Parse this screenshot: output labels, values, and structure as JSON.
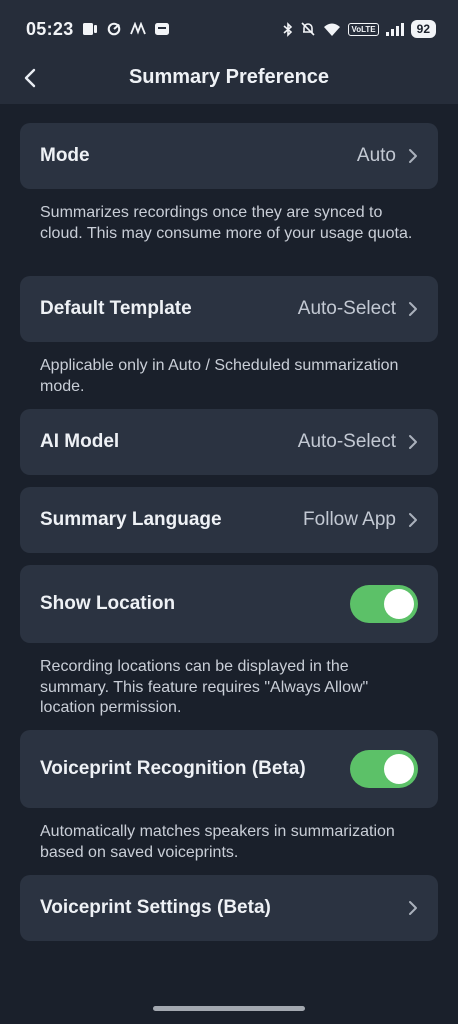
{
  "status_bar": {
    "time": "05:23",
    "volte": "VoLTE",
    "battery": "92"
  },
  "header": {
    "title": "Summary Preference"
  },
  "rows": {
    "mode": {
      "label": "Mode",
      "value": "Auto"
    },
    "default_template": {
      "label": "Default Template",
      "value": "Auto-Select"
    },
    "ai_model": {
      "label": "AI Model",
      "value": "Auto-Select"
    },
    "summary_language": {
      "label": "Summary Language",
      "value": "Follow App"
    },
    "show_location": {
      "label": "Show Location",
      "enabled": true
    },
    "voiceprint_recognition": {
      "label": "Voiceprint Recognition (Beta)",
      "enabled": true
    },
    "voiceprint_settings": {
      "label": "Voiceprint Settings (Beta)"
    }
  },
  "descriptions": {
    "mode": "Summarizes recordings once they are synced to cloud. This may consume more of your usage quota.",
    "default_template": "Applicable only in Auto / Scheduled summarization mode.",
    "show_location": "Recording locations can be displayed in the summary. This feature requires \"Always Allow\" location permission.",
    "voiceprint_recognition": "Automatically matches speakers in summarization based on saved voiceprints."
  },
  "colors": {
    "background": "#1a202b",
    "card": "#2b3341",
    "toggle_on": "#5cc168"
  }
}
